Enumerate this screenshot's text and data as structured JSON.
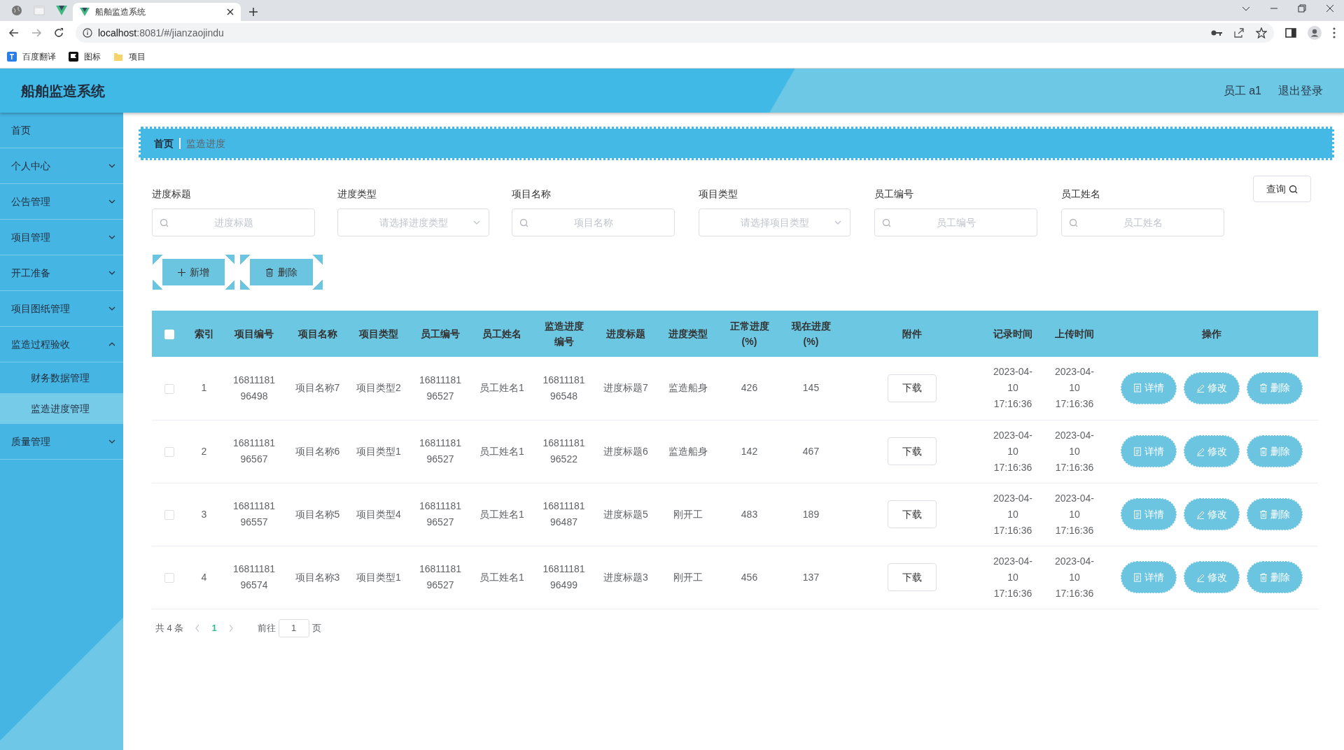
{
  "browser": {
    "tab_title": "船舶监造系统",
    "url_host": "localhost",
    "url_path": ":8081/#/jianzaojindu",
    "bookmarks": [
      "百度翻译",
      "图标",
      "项目"
    ]
  },
  "header": {
    "title": "船舶监造系统",
    "user": "员工 a1",
    "logout": "退出登录"
  },
  "sidebar": {
    "items": [
      {
        "label": "首页",
        "kind": "link",
        "selected": false
      },
      {
        "label": "个人中心",
        "kind": "submenu",
        "expanded": false
      },
      {
        "label": "公告管理",
        "kind": "submenu",
        "expanded": false
      },
      {
        "label": "项目管理",
        "kind": "submenu",
        "expanded": false
      },
      {
        "label": "开工准备",
        "kind": "submenu",
        "expanded": false
      },
      {
        "label": "项目图纸管理",
        "kind": "submenu",
        "expanded": false
      },
      {
        "label": "监造过程验收",
        "kind": "submenu",
        "expanded": true,
        "children": [
          {
            "label": "财务数据管理",
            "selected": false
          },
          {
            "label": "监造进度管理",
            "selected": true
          }
        ]
      },
      {
        "label": "质量管理",
        "kind": "submenu",
        "expanded": false
      }
    ]
  },
  "breadcrumb": [
    "首页",
    "监造进度"
  ],
  "filters": [
    {
      "label": "进度标题",
      "placeholder": "进度标题",
      "kind": "input"
    },
    {
      "label": "进度类型",
      "placeholder": "请选择进度类型",
      "kind": "select"
    },
    {
      "label": "项目名称",
      "placeholder": "项目名称",
      "kind": "input"
    },
    {
      "label": "项目类型",
      "placeholder": "请选择项目类型",
      "kind": "select"
    },
    {
      "label": "员工编号",
      "placeholder": "员工编号",
      "kind": "input"
    },
    {
      "label": "员工姓名",
      "placeholder": "员工姓名",
      "kind": "input"
    }
  ],
  "query_button": "查询",
  "actions": [
    {
      "label": "新增",
      "kind": "add"
    },
    {
      "label": "删除",
      "kind": "delete"
    }
  ],
  "table": {
    "select_all_checked": false,
    "columns": [
      "索引",
      "项目编号",
      "项目名称",
      "项目类型",
      "员工编号",
      "员工姓名",
      "监造进度编号",
      "进度标题",
      "进度类型",
      "正常进度(%)",
      "现在进度(%)",
      "附件",
      "记录时间",
      "上传时间",
      "操作"
    ],
    "rows": [
      {
        "checked": false,
        "cells": [
          "1",
          "1681118196498",
          "项目名称7",
          "项目类型2",
          "1681118196527",
          "员工姓名1",
          "1681118196548",
          "进度标题7",
          "监造船身",
          "426",
          "145"
        ],
        "attachment": "下载",
        "record_time": "2023-04-10 17:16:36",
        "upload_time": "2023-04-10 17:16:36",
        "buttons": [
          "详情",
          "修改",
          "删除"
        ]
      },
      {
        "checked": false,
        "cells": [
          "2",
          "1681118196567",
          "项目名称6",
          "项目类型1",
          "1681118196527",
          "员工姓名1",
          "1681118196522",
          "进度标题6",
          "监造船身",
          "142",
          "467"
        ],
        "attachment": "下载",
        "record_time": "2023-04-10 17:16:36",
        "upload_time": "2023-04-10 17:16:36",
        "buttons": [
          "详情",
          "修改",
          "删除"
        ]
      },
      {
        "checked": false,
        "cells": [
          "3",
          "1681118196557",
          "项目名称5",
          "项目类型4",
          "1681118196527",
          "员工姓名1",
          "1681118196487",
          "进度标题5",
          "刚开工",
          "483",
          "189"
        ],
        "attachment": "下载",
        "record_time": "2023-04-10 17:16:36",
        "upload_time": "2023-04-10 17:16:36",
        "buttons": [
          "详情",
          "修改",
          "删除"
        ]
      },
      {
        "checked": false,
        "cells": [
          "4",
          "1681118196574",
          "项目名称3",
          "项目类型1",
          "1681118196527",
          "员工姓名1",
          "1681118196499",
          "进度标题3",
          "刚开工",
          "456",
          "137"
        ],
        "attachment": "下载",
        "record_time": "2023-04-10 17:16:36",
        "upload_time": "2023-04-10 17:16:36",
        "buttons": [
          "详情",
          "修改",
          "删除"
        ]
      }
    ]
  },
  "pagination": {
    "total": "共 4 条",
    "pages": [
      {
        "label": "1",
        "selected": true
      }
    ],
    "goto_label": "前往",
    "goto_value": "1",
    "page_suffix": "页"
  }
}
